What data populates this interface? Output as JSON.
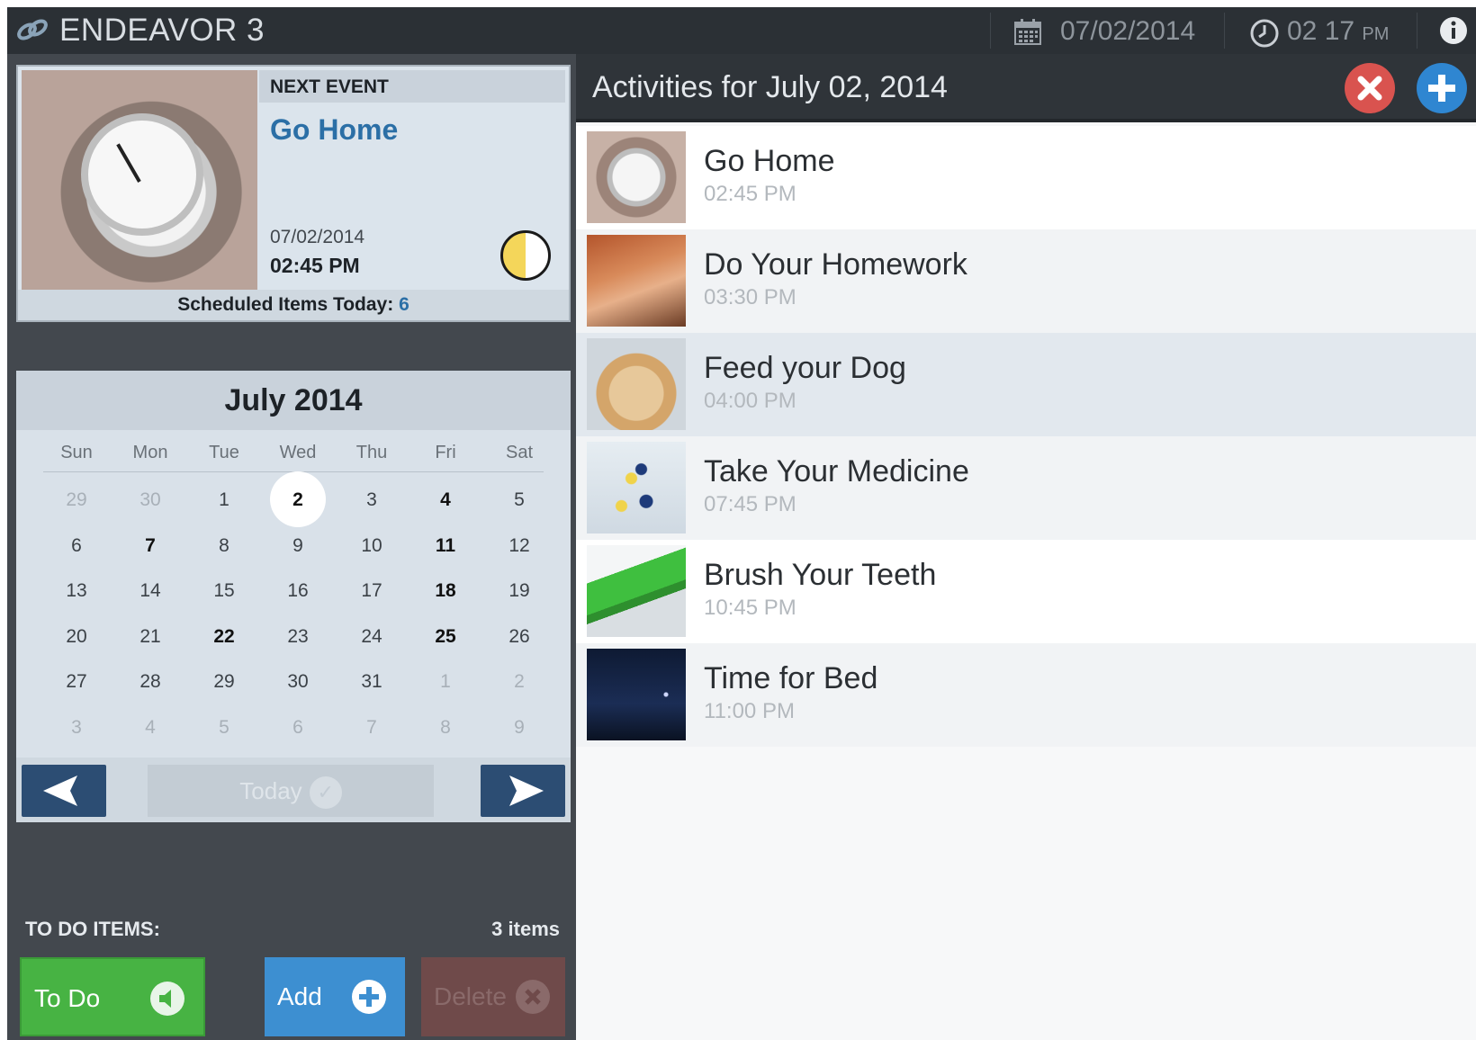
{
  "topbar": {
    "app_title": "ENDEAVOR 3",
    "date": "07/02/2014",
    "time": "02 17",
    "ampm": "PM",
    "icons": [
      "link-icon",
      "calendar-icon",
      "clock-icon",
      "info-icon"
    ]
  },
  "next_event": {
    "label": "NEXT EVENT",
    "title": "Go Home",
    "date": "07/02/2014",
    "time": "02:45 PM",
    "scheduled_label": "Scheduled Items Today:",
    "scheduled_count": "6"
  },
  "calendar": {
    "month_title": "July 2014",
    "days_of_week": [
      "Sun",
      "Mon",
      "Tue",
      "Wed",
      "Thu",
      "Fri",
      "Sat"
    ],
    "weeks": [
      [
        "29",
        "30",
        "1",
        "2",
        "3",
        "4",
        "5"
      ],
      [
        "6",
        "7",
        "8",
        "9",
        "10",
        "11",
        "12"
      ],
      [
        "13",
        "14",
        "15",
        "16",
        "17",
        "18",
        "19"
      ],
      [
        "20",
        "21",
        "22",
        "23",
        "24",
        "25",
        "26"
      ],
      [
        "27",
        "28",
        "29",
        "30",
        "31",
        "1",
        "2"
      ],
      [
        "3",
        "4",
        "5",
        "6",
        "7",
        "8",
        "9"
      ]
    ],
    "selected_day": "2",
    "bold_days": [
      "2",
      "4",
      "7",
      "11",
      "18",
      "22",
      "25"
    ],
    "today_label": "Today"
  },
  "todo": {
    "label": "TO DO ITEMS:",
    "count": "3 items",
    "todo_button": "To Do",
    "add_button": "Add",
    "delete_button": "Delete"
  },
  "activities": {
    "title": "Activities for July 02, 2014",
    "items": [
      {
        "name": "Go Home",
        "time": "02:45 PM",
        "thumb": "stopwatch"
      },
      {
        "name": "Do Your Homework",
        "time": "03:30 PM",
        "thumb": "homework"
      },
      {
        "name": "Feed your Dog",
        "time": "04:00 PM",
        "thumb": "dog"
      },
      {
        "name": "Take Your Medicine",
        "time": "07:45 PM",
        "thumb": "pills"
      },
      {
        "name": "Brush Your Teeth",
        "time": "10:45 PM",
        "thumb": "toothbrush"
      },
      {
        "name": "Time for Bed",
        "time": "11:00 PM",
        "thumb": "night-sky"
      }
    ]
  },
  "colors": {
    "accent_blue": "#2b6fa6",
    "todo_green": "#47b343",
    "add_blue": "#3d8fd1",
    "close_red": "#d9534f"
  }
}
